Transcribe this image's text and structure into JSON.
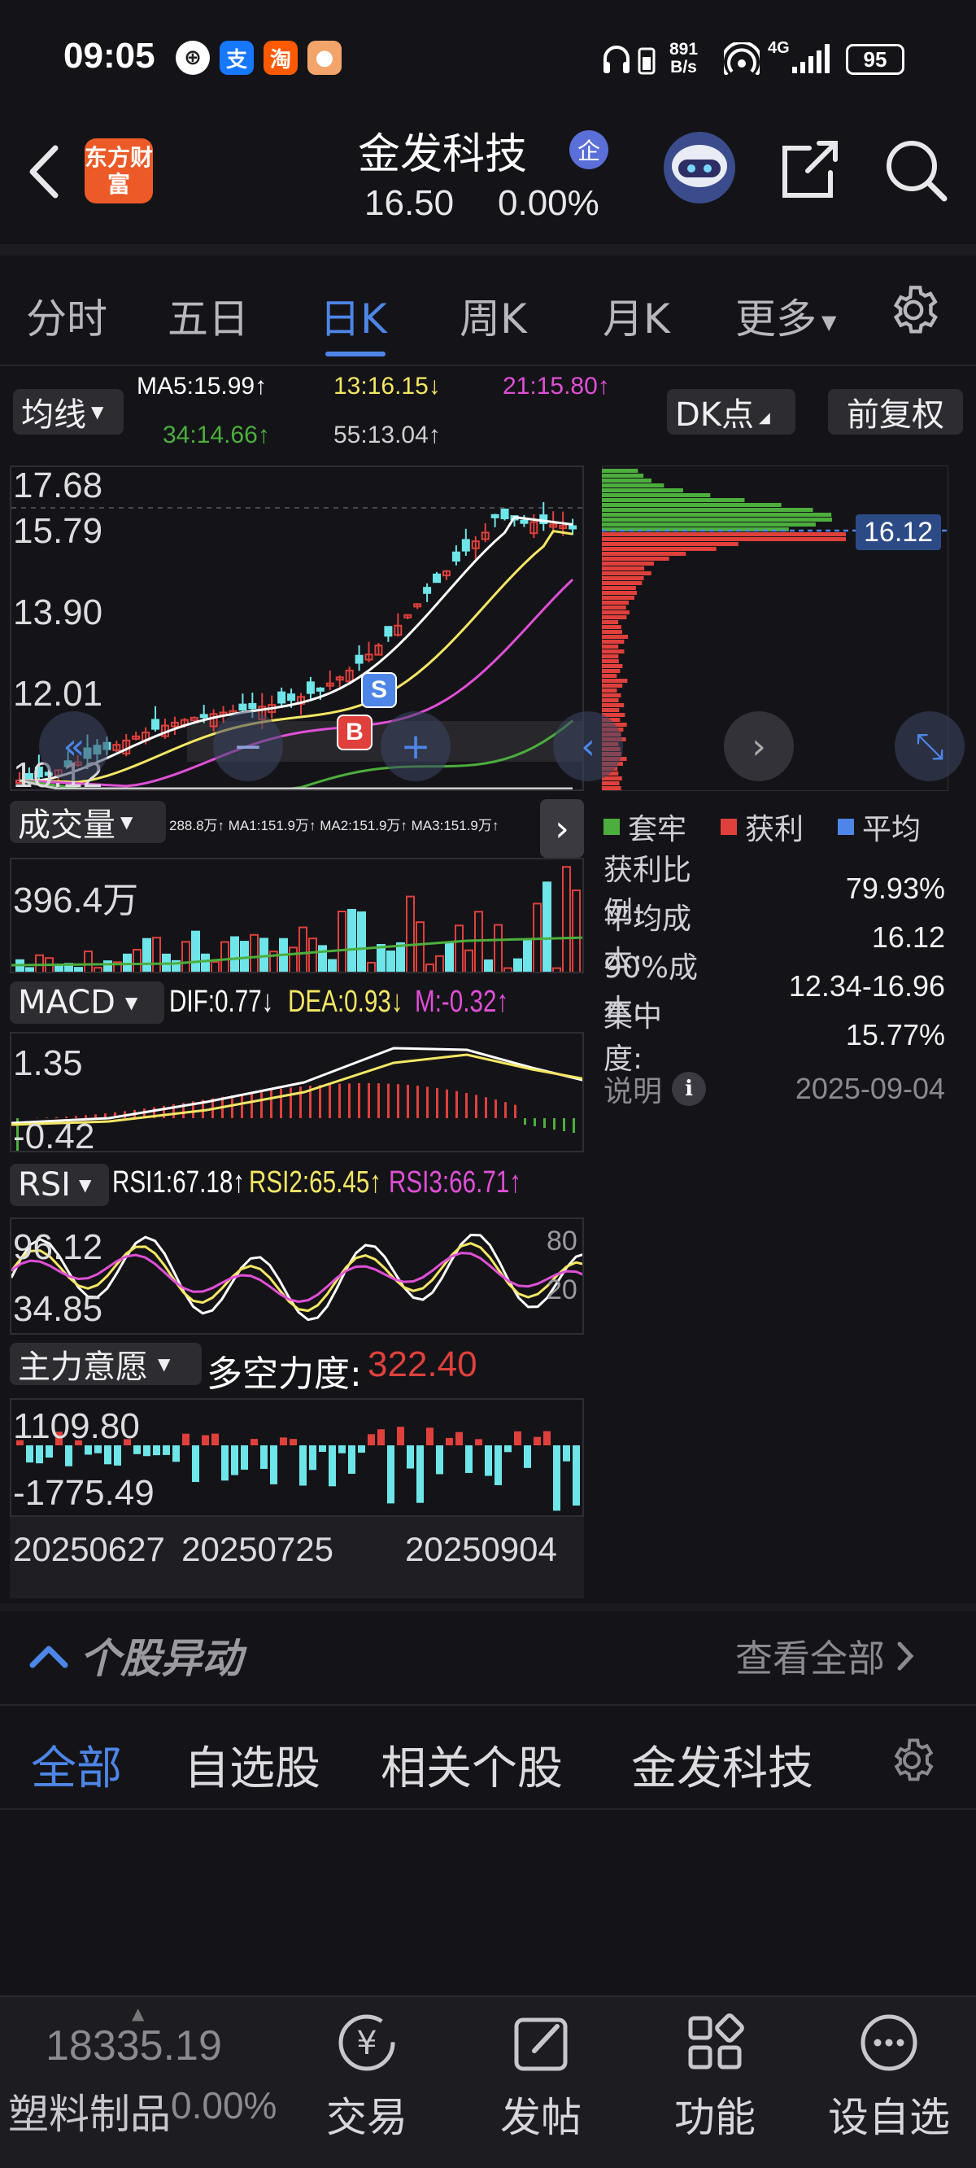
{
  "status_bar": {
    "time": "09:05",
    "net_speed_value": "891",
    "net_speed_unit": "B/s",
    "signal_label": "4G",
    "battery": "95"
  },
  "header": {
    "stock_name": "金发科技",
    "enterprise_badge": "企",
    "price": "16.50",
    "change_pct": "0.00%",
    "brand_logo_text": "东方财富"
  },
  "period_tabs": [
    "分时",
    "五日",
    "日K",
    "周K",
    "月K",
    "更多"
  ],
  "active_period": "日K",
  "ma_bar": {
    "selector": "均线",
    "ma5": "MA5:15.99↑",
    "ma13": "13:16.15↓",
    "ma21": "21:15.80↑",
    "ma34": "34:14.66↑",
    "ma55": "55:13.04↑",
    "dk_button": "DK点",
    "adjust_button": "前复权"
  },
  "price_axis": [
    "17.68",
    "15.79",
    "13.90",
    "12.01",
    "10.12"
  ],
  "cost_marker": "16.12",
  "markers": {
    "sell": "S",
    "buy": "B"
  },
  "volume": {
    "selector": "成交量",
    "legend": "288.8万↑ MA1:151.9万↑ MA2:151.9万↑ MA3:151.9万↑",
    "axis_top": "396.4万"
  },
  "macd": {
    "selector": "MACD",
    "dif": "DIF:0.77↓",
    "dea": "DEA:0.93↓",
    "m": "M:-0.32↑",
    "axis_top": "1.35",
    "axis_bottom": "-0.42"
  },
  "rsi": {
    "selector": "RSI",
    "rsi1": "RSI1:67.18↑",
    "rsi2": "RSI2:65.45↑",
    "rsi3": "RSI3:66.71↑",
    "axis_top": "96.12",
    "axis_bottom": "34.85",
    "ref_high": "80",
    "ref_low": "20"
  },
  "main_force": {
    "selector": "主力意愿",
    "label": "多空力度:",
    "value": "322.40",
    "axis_top": "1109.80",
    "axis_bottom": "-1775.49"
  },
  "dates": [
    "20250627",
    "20250725",
    "20250904"
  ],
  "chips": {
    "legend": [
      "套牢",
      "获利",
      "平均"
    ],
    "stats": [
      {
        "label": "获利比例:",
        "value": "79.93%"
      },
      {
        "label": "平均成本:",
        "value": "16.12"
      },
      {
        "label": "90%成本:",
        "value": "12.34-16.96"
      },
      {
        "label": "集中度:",
        "value": "15.77%"
      }
    ],
    "note_label": "说明",
    "note_date": "2025-09-04"
  },
  "movers": {
    "title": "个股异动",
    "view_all": "查看全部",
    "tabs": [
      "全部",
      "自选股",
      "相关个股",
      "金发科技"
    ],
    "active_tab": "全部"
  },
  "bottom_bar": {
    "index_value": "18335.19",
    "sector_name": "塑料制品",
    "sector_change": "0.00%",
    "items": [
      "交易",
      "发帖",
      "功能",
      "设自选"
    ]
  },
  "colors": {
    "up": "#e0403c",
    "down": "#6ee5e8",
    "accent": "#4e86e8",
    "ma5": "#ffffff",
    "ma13": "#f5e663",
    "ma21": "#e04fd6",
    "ma34": "#4cae3c",
    "ma55": "#cfcfcf"
  }
}
